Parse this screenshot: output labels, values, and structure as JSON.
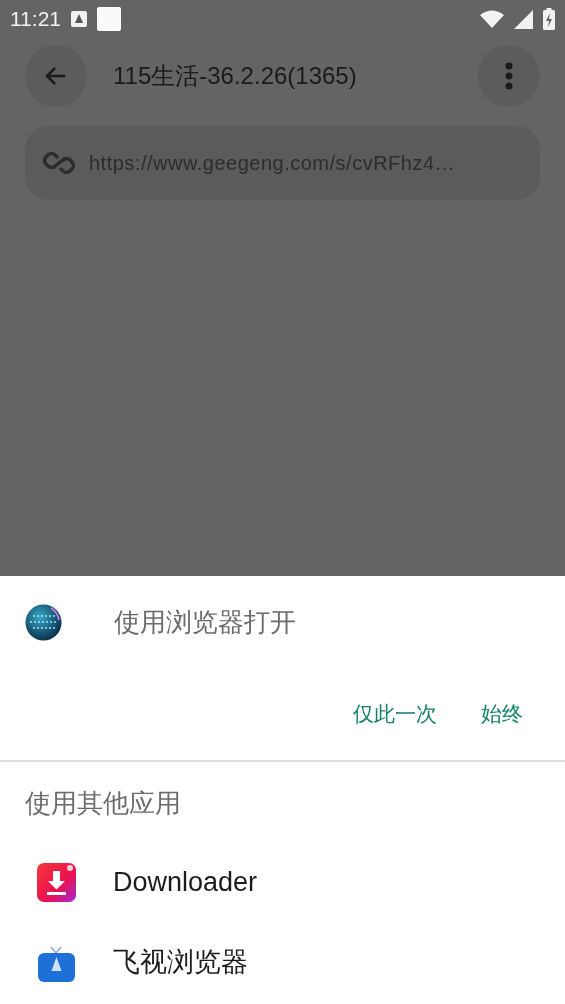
{
  "status_bar": {
    "time": "11:21"
  },
  "app_bar": {
    "title": "115生活-36.2.26(1365)"
  },
  "url_field": {
    "value": "https://www.geegeng.com/s/cvRFhz4…"
  },
  "sheet": {
    "title": "使用浏览器打开",
    "actions": [
      "仅此一次",
      "始终"
    ],
    "section_title": "使用其他应用",
    "apps": [
      {
        "name": "Downloader",
        "kind": "downloader"
      },
      {
        "name": "飞视浏览器",
        "kind": "tv"
      }
    ]
  }
}
